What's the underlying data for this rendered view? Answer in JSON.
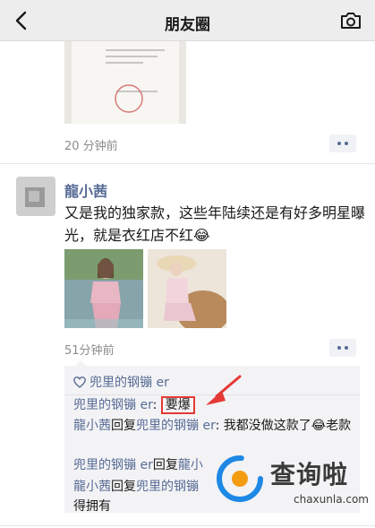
{
  "nav": {
    "title": "朋友圈"
  },
  "post1": {
    "time": "20 分钟前"
  },
  "post2": {
    "author": "龍小茜",
    "text": "又是我的独家款，这些年陆续还是有好多明星曝光，就是衣红店不红😂",
    "time": "51分钟前",
    "likes": "兜里的钢镚 er",
    "comments": [
      {
        "name": "兜里的钢镚 er",
        "sep": ": ",
        "text": "要爆"
      },
      {
        "name": "龍小茜",
        "verb": "回复",
        "target": "兜里的钢镚 er",
        "sep": ": ",
        "text": "我都没做这款了😂老款"
      },
      {
        "name": "兜里的钢镚 er",
        "verb": "回复",
        "target": "龍小"
      },
      {
        "name": "龍小茜",
        "verb": "回复",
        "target": "兜里的钢镚",
        "text": "得拥有"
      }
    ]
  },
  "watermark": {
    "brand": "查询啦",
    "url": "chaxunla.com"
  },
  "colors": {
    "link": "#576b95",
    "highlight": "#e53935",
    "navbar": "#ededed",
    "comment_bg": "#f3f3f5"
  }
}
